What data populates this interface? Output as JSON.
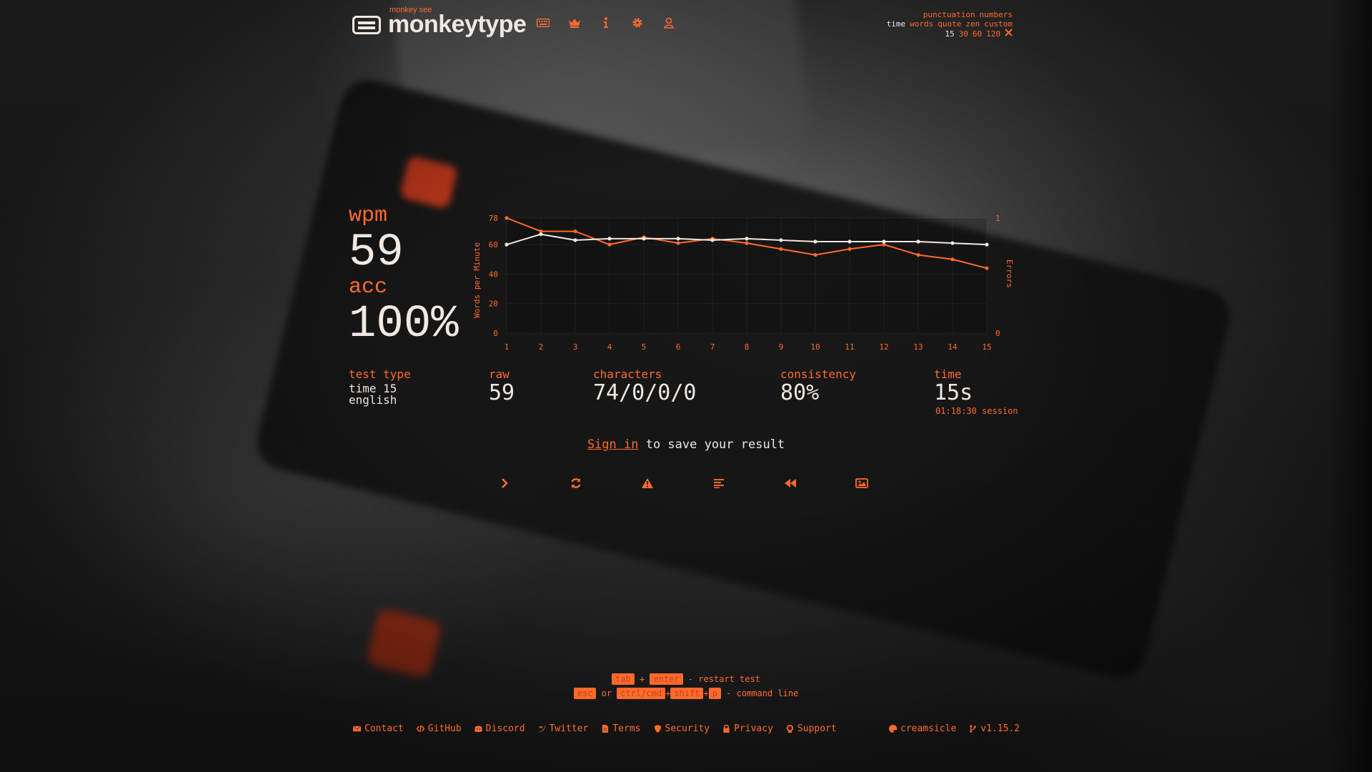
{
  "header": {
    "logo_sub": "monkey see",
    "logo_title": "monkeytype",
    "nav": [
      {
        "icon": "keyboard-icon"
      },
      {
        "icon": "crown-icon"
      },
      {
        "icon": "info-icon"
      },
      {
        "icon": "gear-icon"
      },
      {
        "icon": "user-icon"
      }
    ]
  },
  "config": {
    "row1": [
      "punctuation",
      "numbers"
    ],
    "row2": [
      "time",
      "words",
      "quote",
      "zen",
      "custom"
    ],
    "row2_active": "time",
    "row3": [
      "15",
      "30",
      "60",
      "120"
    ],
    "row3_active": "15",
    "row3_icon": "tools-icon"
  },
  "results": {
    "wpm_label": "wpm",
    "wpm_value": "59",
    "acc_label": "acc",
    "acc_value": "100%",
    "test_type_label": "test type",
    "test_type_line1": "time 15",
    "test_type_line2": "english",
    "raw_label": "raw",
    "raw_value": "59",
    "characters_label": "characters",
    "characters_value": "74/0/0/0",
    "consistency_label": "consistency",
    "consistency_value": "80%",
    "time_label": "time",
    "time_value": "15s",
    "session_text": "01:18:30 session"
  },
  "signin": {
    "link": "Sign in",
    "rest": " to save your result"
  },
  "actions": [
    {
      "icon": "chevron-right-icon"
    },
    {
      "icon": "refresh-icon"
    },
    {
      "icon": "warning-icon"
    },
    {
      "icon": "list-icon"
    },
    {
      "icon": "rewind-icon"
    },
    {
      "icon": "image-icon"
    }
  ],
  "hints": {
    "line1": {
      "k1": "tab",
      "plus": "+",
      "k2": "enter",
      "text": "- restart test"
    },
    "line2": {
      "k1": "esc",
      "or": "or",
      "k2": "ctrl/cmd",
      "plus1": "+",
      "k3": "shift",
      "plus2": "+",
      "k4": "p",
      "text": "- command line"
    }
  },
  "footer": {
    "links": [
      {
        "label": "Contact",
        "icon": "envelope-icon"
      },
      {
        "label": "GitHub",
        "icon": "code-icon"
      },
      {
        "label": "Discord",
        "icon": "discord-icon"
      },
      {
        "label": "Twitter",
        "icon": "twitter-icon"
      },
      {
        "label": "Terms",
        "icon": "document-icon"
      },
      {
        "label": "Security",
        "icon": "shield-icon"
      },
      {
        "label": "Privacy",
        "icon": "lock-icon"
      },
      {
        "label": "Support",
        "icon": "support-icon"
      }
    ],
    "theme": "creamsicle",
    "version": "v1.15.2"
  },
  "colors": {
    "accent": "#ff6a2c",
    "text": "#f0e8e2"
  },
  "chart_data": {
    "type": "line",
    "x": [
      1,
      2,
      3,
      4,
      5,
      6,
      7,
      8,
      9,
      10,
      11,
      12,
      13,
      14,
      15
    ],
    "series": [
      {
        "color": "#f0e8e2",
        "values": [
          60,
          67,
          63,
          64,
          64,
          64,
          63,
          64,
          63,
          62,
          62,
          62,
          62,
          61,
          60
        ]
      },
      {
        "color": "#ff6a2c",
        "values": [
          78,
          69,
          69,
          60,
          65,
          61,
          64,
          61,
          57,
          53,
          57,
          60,
          53,
          50,
          44
        ]
      }
    ],
    "ylabel": "Words per Minute",
    "y2label": "Errors",
    "yticks": [
      "78",
      "60",
      "40",
      "20",
      "0"
    ],
    "ylim": [
      0,
      78
    ],
    "y2ticks": [
      "1",
      "0"
    ],
    "y2lim": [
      0,
      1
    ],
    "xticks": [
      "1",
      "2",
      "3",
      "4",
      "5",
      "6",
      "7",
      "8",
      "9",
      "10",
      "11",
      "12",
      "13",
      "14",
      "15"
    ]
  }
}
